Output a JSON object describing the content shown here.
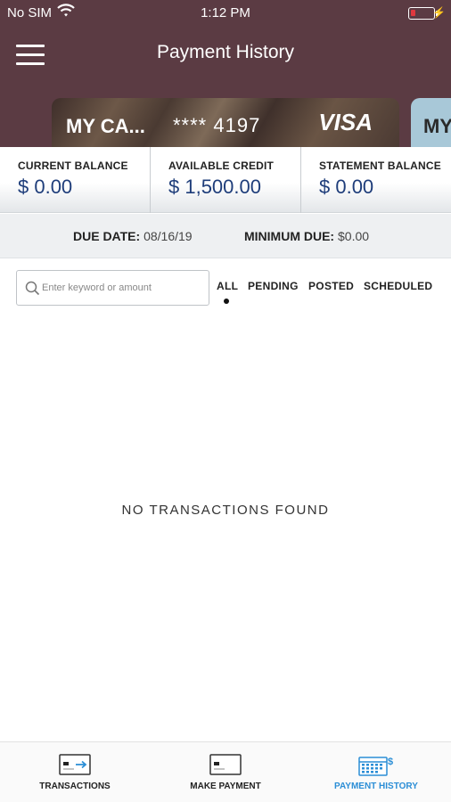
{
  "status_bar": {
    "carrier": "No SIM",
    "time": "1:12 PM"
  },
  "header": {
    "title": "Payment History"
  },
  "card": {
    "name": "MY CA...",
    "number": "**** 4197",
    "network": "VISA"
  },
  "next_card": {
    "name": "MY"
  },
  "balances": [
    {
      "label": "CURRENT BALANCE",
      "value": "$ 0.00"
    },
    {
      "label": "AVAILABLE CREDIT",
      "value": "$ 1,500.00"
    },
    {
      "label": "STATEMENT BALANCE",
      "value": "$ 0.00"
    }
  ],
  "due": {
    "date_label": "DUE DATE:",
    "date_value": "08/16/19",
    "min_label": "MINIMUM DUE:",
    "min_value": "$0.00"
  },
  "search": {
    "placeholder": "Enter keyword or amount",
    "value": ""
  },
  "filters": [
    {
      "label": "ALL",
      "selected": true
    },
    {
      "label": "PENDING",
      "selected": false
    },
    {
      "label": "POSTED",
      "selected": false
    },
    {
      "label": "SCHEDULED",
      "selected": false
    }
  ],
  "empty_message": "NO TRANSACTIONS FOUND",
  "tabs": [
    {
      "label": "TRANSACTIONS",
      "icon": "transactions-card-icon",
      "active": false
    },
    {
      "label": "MAKE PAYMENT",
      "icon": "payment-card-icon",
      "active": false
    },
    {
      "label": "PAYMENT HISTORY",
      "icon": "calendar-dollar-icon",
      "active": true
    }
  ],
  "colors": {
    "header_bg": "#5b3b43",
    "balance_value": "#1e3d7a",
    "active_tab": "#2b8ed6",
    "battery_low": "#e0383e"
  }
}
